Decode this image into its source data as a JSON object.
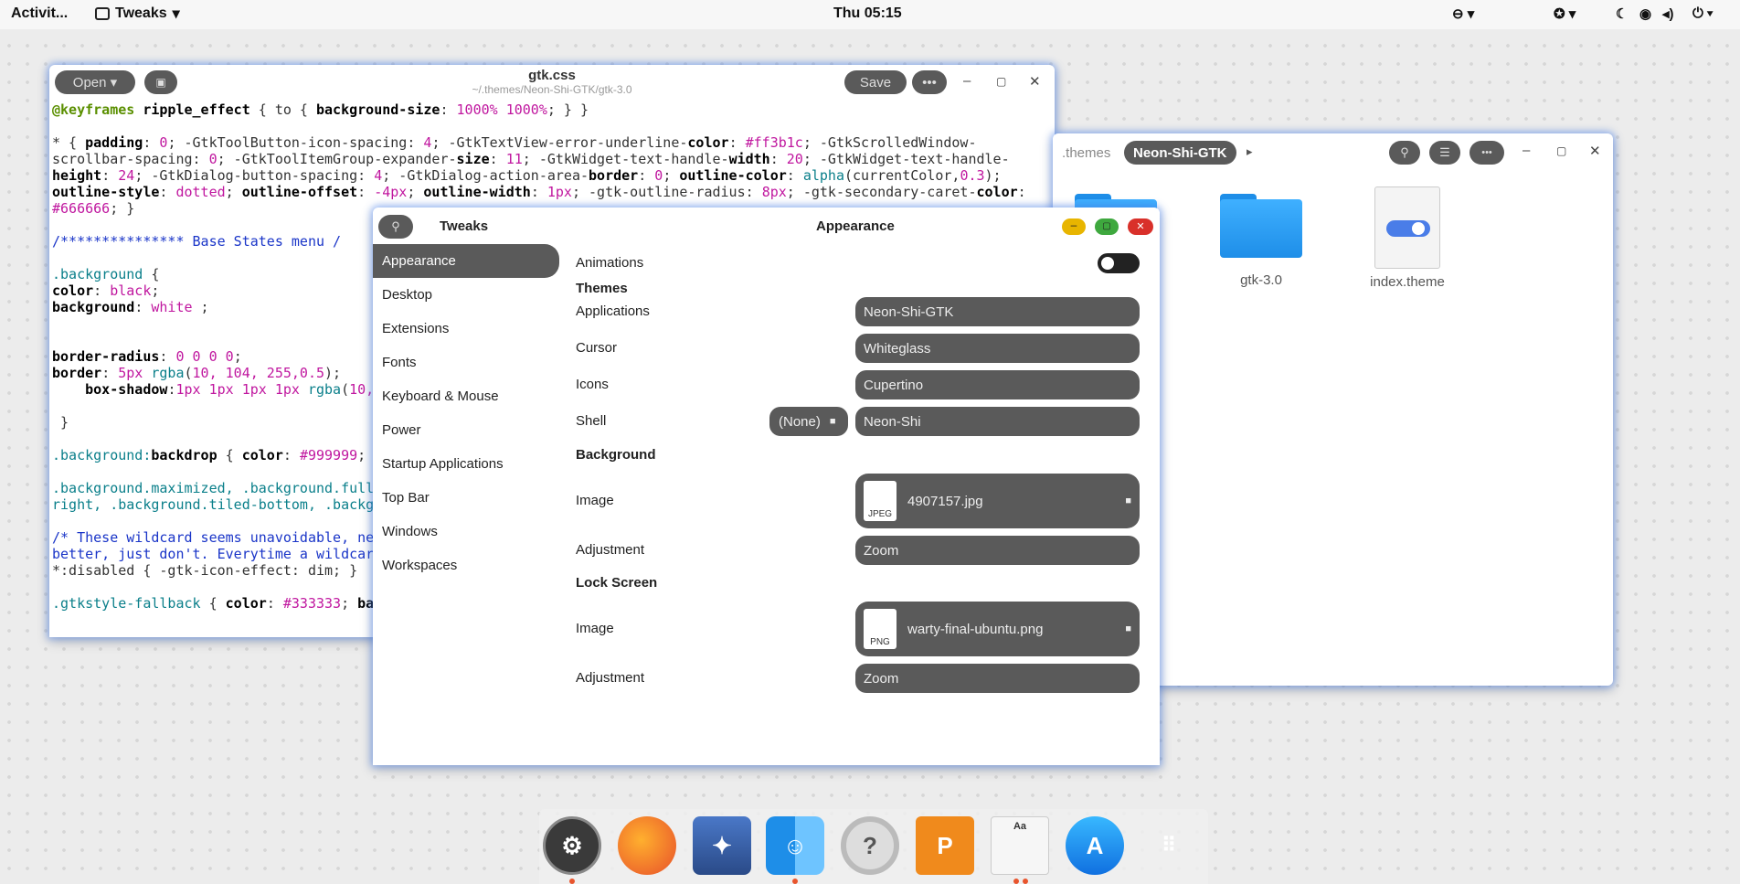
{
  "topbar": {
    "activities": "Activit...",
    "app_name": "Tweaks",
    "clock": "Thu 05:15"
  },
  "editor": {
    "open_label": "Open",
    "title": "gtk.css",
    "subtitle": "~/.themes/Neon-Shi-GTK/gtk-3.0",
    "save_label": "Save"
  },
  "files": {
    "crumb_prev": ".themes",
    "crumb_current": "Neon-Shi-GTK",
    "items": [
      "gtk-3.0",
      "index.theme"
    ]
  },
  "tweaks": {
    "app_title": "Tweaks",
    "page_title": "Appearance",
    "sidebar": [
      "Appearance",
      "Desktop",
      "Extensions",
      "Fonts",
      "Keyboard & Mouse",
      "Power",
      "Startup Applications",
      "Top Bar",
      "Windows",
      "Workspaces"
    ],
    "animations_label": "Animations",
    "themes_header": "Themes",
    "applications_label": "Applications",
    "applications_value": "Neon-Shi-GTK",
    "cursor_label": "Cursor",
    "cursor_value": "Whiteglass",
    "icons_label": "Icons",
    "icons_value": "Cupertino",
    "shell_label": "Shell",
    "shell_none": "(None)",
    "shell_value": "Neon-Shi",
    "background_header": "Background",
    "bg_image_label": "Image",
    "bg_image_value": "4907157.jpg",
    "bg_image_type": "JPEG",
    "bg_adjust_label": "Adjustment",
    "bg_adjust_value": "Zoom",
    "lock_header": "Lock Screen",
    "lock_image_label": "Image",
    "lock_image_value": "warty-final-ubuntu.png",
    "lock_image_type": "PNG",
    "lock_adjust_label": "Adjustment",
    "lock_adjust_value": "Zoom"
  },
  "dock": {
    "icons": [
      "settings-icon",
      "firefox-icon",
      "eagle-icon",
      "finder-icon",
      "help-icon",
      "presentation-icon",
      "font-viewer-icon",
      "app-store-icon",
      "app-grid-icon"
    ]
  },
  "colors": {
    "accent": "#5a5a5a",
    "folder": "#1e8ee8",
    "close": "#d9302a",
    "minimize": "#e8b500",
    "maximize": "#3ea83e"
  }
}
